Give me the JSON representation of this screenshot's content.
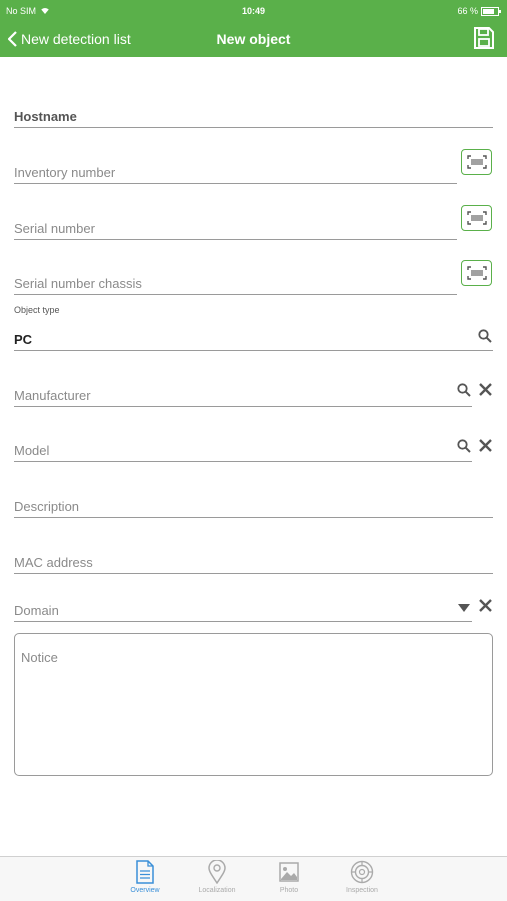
{
  "status_bar": {
    "carrier": "No SIM",
    "time": "10:49",
    "battery": "66 %"
  },
  "nav": {
    "back_label": "New detection list",
    "title": "New object"
  },
  "form": {
    "hostname": {
      "placeholder": "Hostname"
    },
    "inventory_number": {
      "placeholder": "Inventory number"
    },
    "serial_number": {
      "placeholder": "Serial number"
    },
    "serial_number_chassis": {
      "placeholder": "Serial number chassis"
    },
    "object_type": {
      "label": "Object type",
      "value": "PC"
    },
    "manufacturer": {
      "placeholder": "Manufacturer"
    },
    "model": {
      "placeholder": "Model"
    },
    "description": {
      "placeholder": "Description"
    },
    "mac_address": {
      "placeholder": "MAC address"
    },
    "domain": {
      "placeholder": "Domain"
    },
    "notice": {
      "placeholder": "Notice"
    }
  },
  "tabs": [
    {
      "label": "Overview",
      "icon": "document-icon",
      "active": true
    },
    {
      "label": "Localization",
      "icon": "location-pin-icon",
      "active": false
    },
    {
      "label": "Photo",
      "icon": "photo-icon",
      "active": false
    },
    {
      "label": "Inspection",
      "icon": "inspection-icon",
      "active": false
    }
  ],
  "colors": {
    "accent": "#5ab04a",
    "tab_active": "#3a8fd8"
  }
}
